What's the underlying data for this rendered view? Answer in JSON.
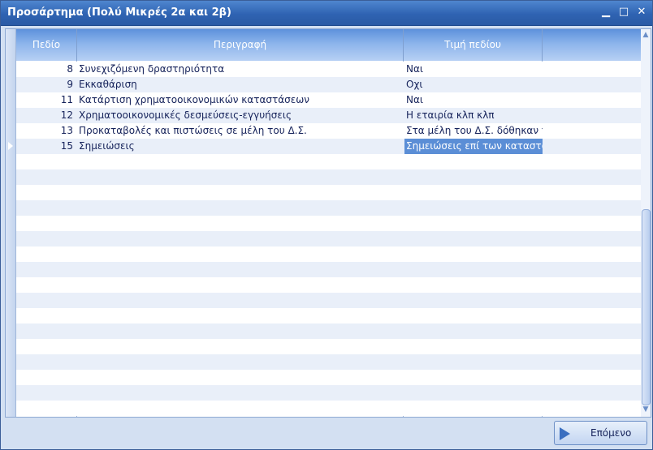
{
  "window": {
    "title": "Προσάρτημα (Πολύ Μικρές 2α και 2β)"
  },
  "table": {
    "columns": [
      "Πεδίο",
      "Περιγραφή",
      "Τιμή πεδίου"
    ],
    "rows": [
      {
        "field": "8",
        "description": "Συνεχιζόμενη δραστηριότητα",
        "value": "Ναι"
      },
      {
        "field": "9",
        "description": "Εκκαθάριση",
        "value": "Οχι"
      },
      {
        "field": "11",
        "description": "Κατάρτιση χρηματοοικονομικών καταστάσεων",
        "value": "Ναι"
      },
      {
        "field": "12",
        "description": "Χρηματοοικονομικές δεσμεύσεις-εγγυήσεις",
        "value": "Η εταιρία κλπ κλπ"
      },
      {
        "field": "13",
        "description": "Προκαταβολές και πιστώσεις σε μέλη του Δ.Σ.",
        "value": "Στα μέλη του Δ.Σ. δόθηκαν πι"
      },
      {
        "field": "15",
        "description": "Σημειώσεις",
        "value": "Σημειώσεις επί των καταστάσ"
      }
    ],
    "selected_row": 5
  },
  "footer": {
    "next_label": "Επόμενο"
  },
  "colors": {
    "title_bar": "#2f63b2",
    "header": "#5d91dc",
    "alt_row": "#e9eff9",
    "selected_cell": "#5b8ed6"
  }
}
